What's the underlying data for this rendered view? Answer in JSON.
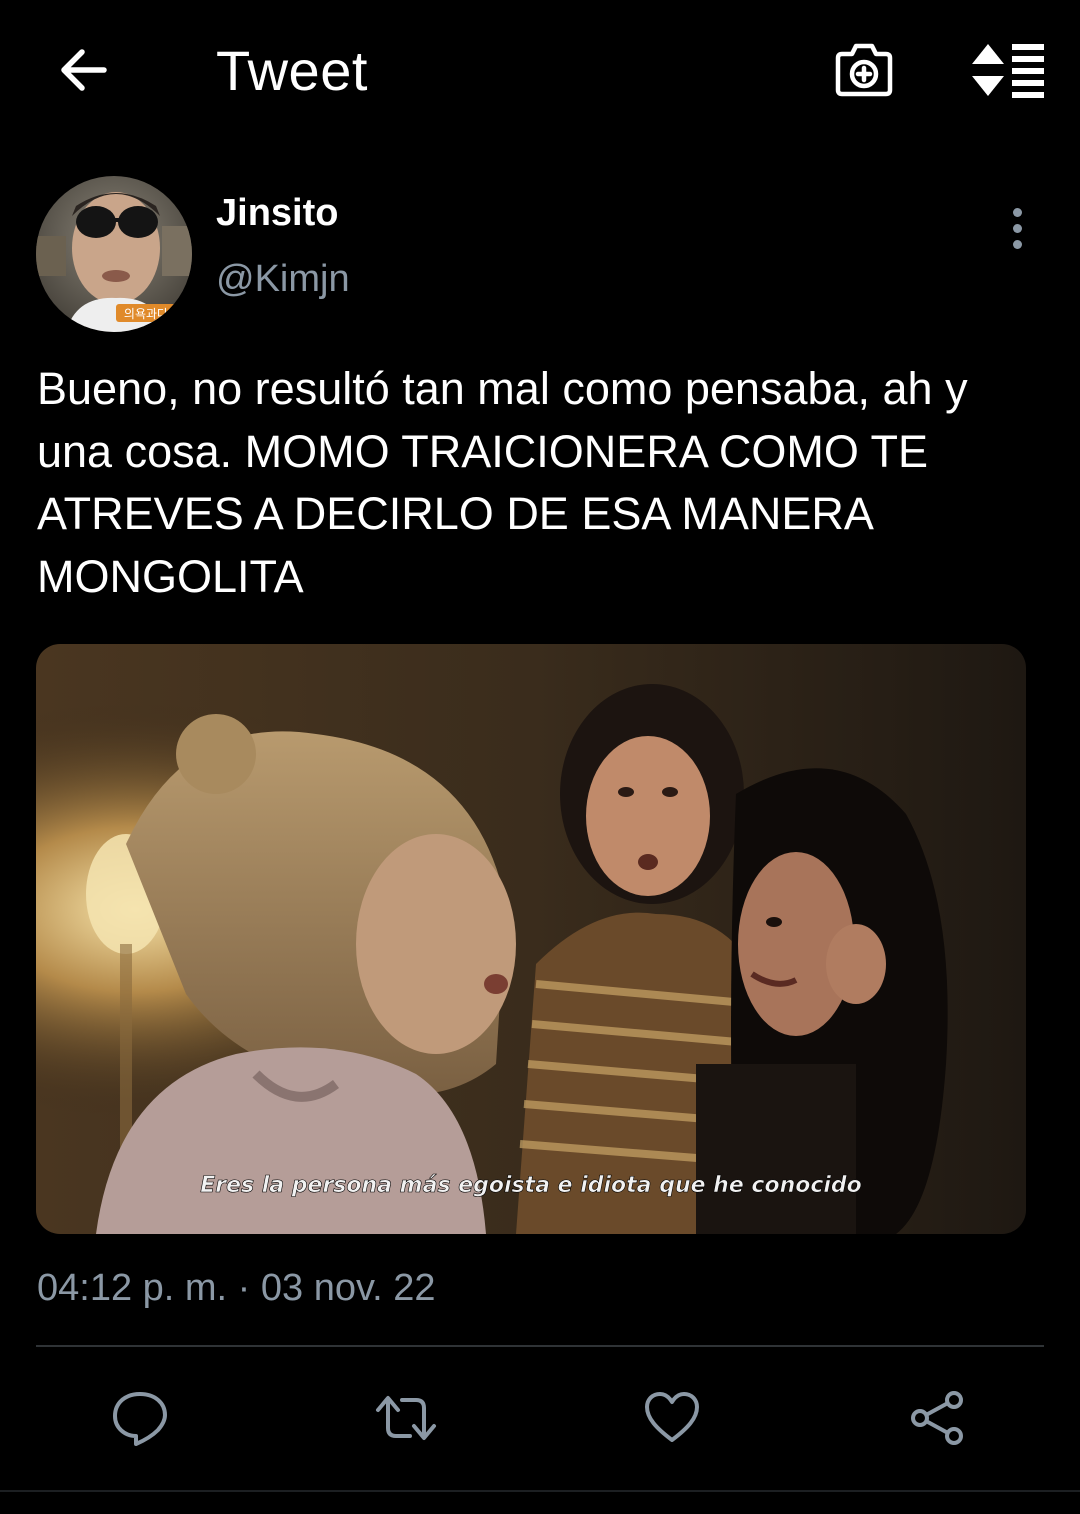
{
  "colors": {
    "background": "#000000",
    "text_primary": "#ffffff",
    "text_secondary": "#8b98a5",
    "divider": "#2f3336"
  },
  "header": {
    "title": "Tweet",
    "back_icon": "arrow-left-icon",
    "camera_icon": "camera-plus-icon",
    "sort_icon": "sort-reorder-icon"
  },
  "tweet": {
    "author": {
      "display_name": "Jinsito",
      "handle": "@Kimjn",
      "avatar_caption": "의욕과다"
    },
    "more_icon": "more-vertical-icon",
    "text": "Bueno, no resultó tan mal como pensaba, ah y una cosa. MOMO TRAICIONERA COMO TE ATREVES A DECIRLO DE ESA MANERA MONGOLITA",
    "media": {
      "subtitle": "Eres la persona más egoista e idiota que he conocido"
    },
    "timestamp": "04:12 p. m. · 03 nov. 22"
  },
  "actions": {
    "reply_icon": "reply-bubble-icon",
    "retweet_icon": "retweet-icon",
    "like_icon": "heart-icon",
    "share_icon": "share-icon"
  }
}
